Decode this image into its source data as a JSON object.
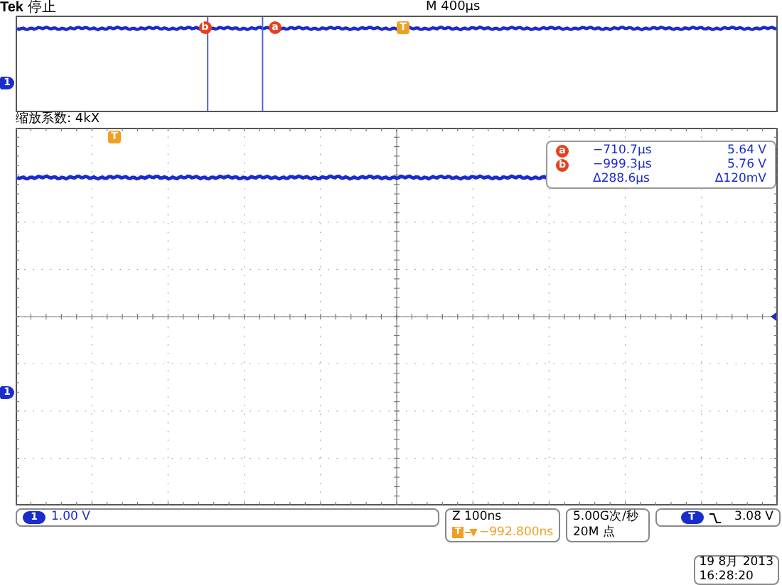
{
  "header": {
    "brand": "Tek",
    "state": "停止",
    "timebase": "M 400µs"
  },
  "overview": {
    "cursor_markers": [
      {
        "label": "b"
      },
      {
        "label": "a"
      }
    ],
    "trigger_marker": "T",
    "channel_marker": "1"
  },
  "zoom_factor": "缩放系数: 4kX",
  "main": {
    "trigger_marker": "T",
    "channel_marker": "1",
    "readout": {
      "rows": [
        {
          "marker": "a",
          "time": "−710.7µs",
          "voltage": "5.64 V"
        },
        {
          "marker": "b",
          "time": "−999.3µs",
          "voltage": "5.76 V"
        }
      ],
      "delta": {
        "time": "Δ288.6µs",
        "voltage": "Δ120mV"
      }
    }
  },
  "status": {
    "channel": {
      "marker": "1",
      "scale": "1.00 V"
    },
    "zoom": {
      "scale": "Z 100ns",
      "trigger_marker": "T",
      "position": "−992.800ns"
    },
    "sampling": {
      "rate": "5.00G次/秒",
      "points": "20M 点"
    },
    "trigger": {
      "marker": "T",
      "level": "3.08 V"
    },
    "datetime": {
      "date": "19 8月 2013",
      "time": "16:28:20"
    }
  }
}
